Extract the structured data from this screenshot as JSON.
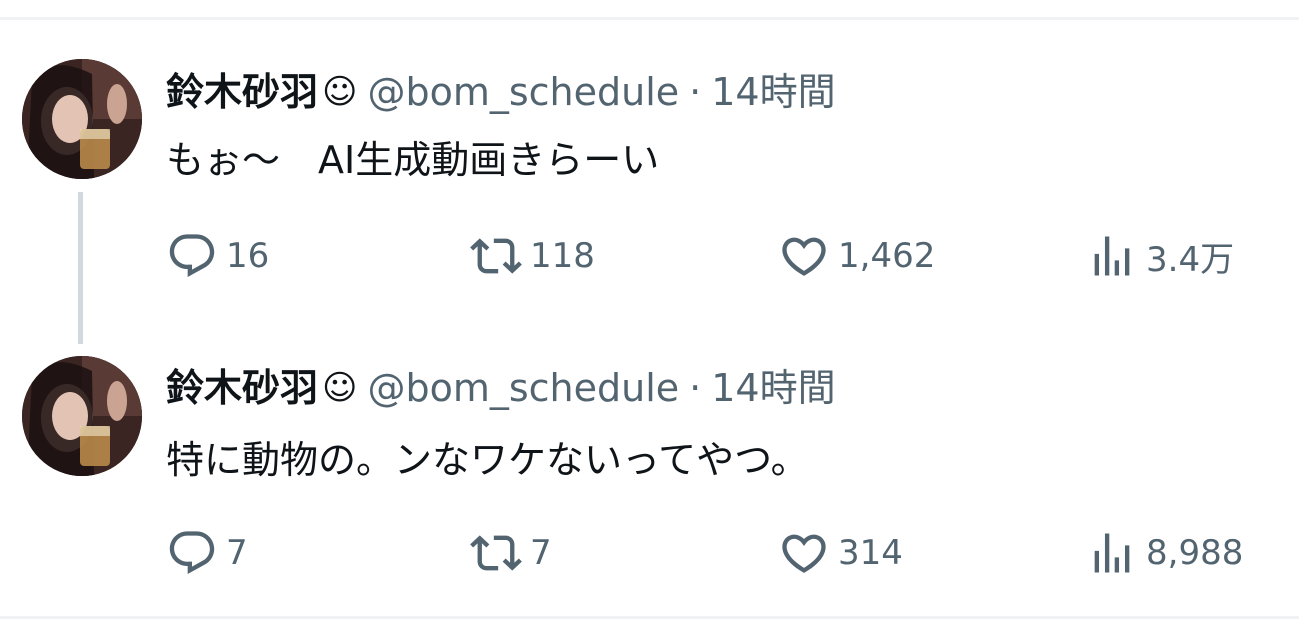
{
  "tweets": [
    {
      "author_name": "鈴木砂羽",
      "author_emoji": "☺",
      "handle": "@bom_schedule",
      "separator": "·",
      "time": "14時間",
      "text": "もぉ～　AI生成動画きらーい",
      "replies": "16",
      "retweets": "118",
      "likes": "1,462",
      "views": "3.4万"
    },
    {
      "author_name": "鈴木砂羽",
      "author_emoji": "☺",
      "handle": "@bom_schedule",
      "separator": "·",
      "time": "14時間",
      "text": "特に動物の。ンなワケないってやつ。",
      "replies": "7",
      "retweets": "7",
      "likes": "314",
      "views": "8,988"
    }
  ],
  "icons": {
    "reply": "reply-icon",
    "retweet": "retweet-icon",
    "like": "heart-icon",
    "views": "views-icon"
  },
  "colors": {
    "text_primary": "#0f1419",
    "text_secondary": "#536471",
    "thread_line": "#cfd9de",
    "divider": "#eff3f4"
  }
}
